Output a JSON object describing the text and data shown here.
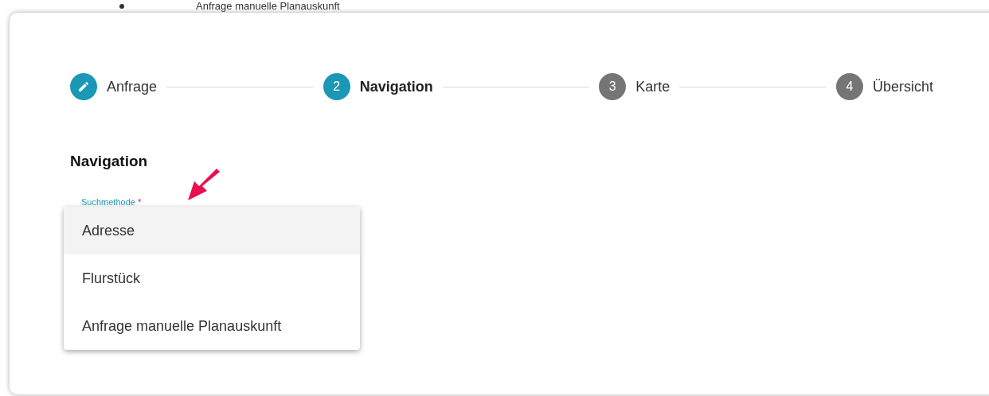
{
  "bullet_line": {
    "text": "Anfrage manuelle Planauskunft"
  },
  "steps": [
    {
      "label": "Anfrage",
      "completed": true,
      "selected": false
    },
    {
      "number": "2",
      "label": "Navigation",
      "completed": false,
      "selected": true
    },
    {
      "number": "3",
      "label": "Karte",
      "completed": false,
      "selected": false
    },
    {
      "number": "4",
      "label": "Übersicht",
      "completed": false,
      "selected": false
    }
  ],
  "section_title": "Navigation",
  "field": {
    "label": "Suchmethode",
    "required_mark": "*"
  },
  "menu": [
    {
      "label": "Adresse",
      "selected": true
    },
    {
      "label": "Flurstück",
      "selected": false
    },
    {
      "label": "Anfrage manuelle Planauskunft",
      "selected": false
    }
  ]
}
